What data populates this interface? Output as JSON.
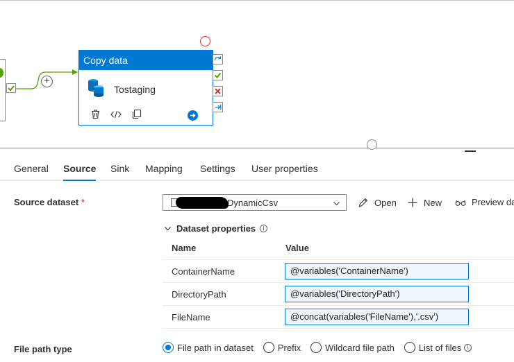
{
  "activity": {
    "header": "Copy data",
    "name": "Tostaging"
  },
  "tabs": [
    {
      "label": "General"
    },
    {
      "label": "Source"
    },
    {
      "label": "Sink"
    },
    {
      "label": "Mapping"
    },
    {
      "label": "Settings"
    },
    {
      "label": "User properties"
    }
  ],
  "source": {
    "dataset_label": "Source dataset",
    "required_mark": "*",
    "dataset_value": "DynamicCsv",
    "open_label": "Open",
    "new_label": "New",
    "preview_label": "Preview da",
    "dataset_properties_label": "Dataset properties",
    "info_glyph": "i",
    "table_headers": {
      "name": "Name",
      "value": "Value"
    },
    "params": [
      {
        "name": "ContainerName",
        "value": "@variables('ContainerName')"
      },
      {
        "name": "DirectoryPath",
        "value": "@variables('DirectoryPath')"
      },
      {
        "name": "FileName",
        "value": "@concat(variables('FileName'),'.csv')"
      }
    ],
    "file_path_type_label": "File path type",
    "file_path_options": [
      {
        "label": "File path in dataset",
        "selected": true
      },
      {
        "label": "Prefix",
        "selected": false
      },
      {
        "label": "Wildcard file path",
        "selected": false
      },
      {
        "label": "List of files",
        "selected": false
      }
    ]
  },
  "colors": {
    "accent": "#0078d4",
    "success": "#57a300",
    "error": "#d13438"
  }
}
